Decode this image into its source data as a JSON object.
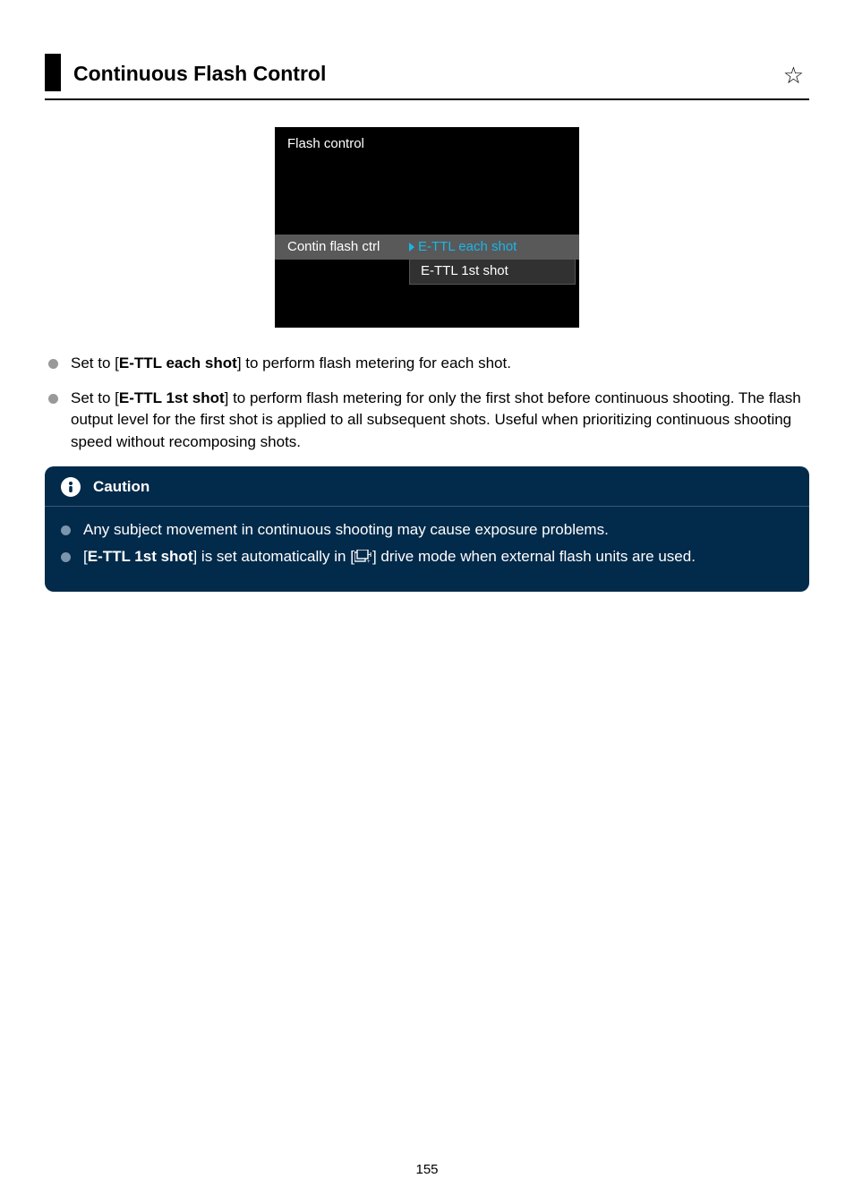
{
  "heading": "Continuous Flash Control",
  "star_glyph": "☆",
  "device_screen": {
    "title": "Flash control",
    "row_label": "Contin flash ctrl",
    "option_selected": "E-TTL each shot",
    "option_other": "E-TTL 1st shot"
  },
  "bullets": [
    {
      "prefix": "Set to [",
      "bold": "E-TTL each shot",
      "suffix": "] to perform flash metering for each shot."
    },
    {
      "prefix": "Set to [",
      "bold": "E-TTL 1st shot",
      "suffix": "] to perform flash metering for only the first shot before continuous shooting. The flash output level for the first shot is applied to all subsequent shots. Useful when prioritizing continuous shooting speed without recomposing shots."
    }
  ],
  "caution": {
    "title": "Caution",
    "items": [
      {
        "text": "Any subject movement in continuous shooting may cause exposure problems."
      },
      {
        "prefix": "[",
        "bold": "E-TTL 1st shot",
        "mid": "] is set automatically in [",
        "icon": true,
        "suffix": "] drive mode when external flash units are used."
      }
    ]
  },
  "page_number": "155"
}
